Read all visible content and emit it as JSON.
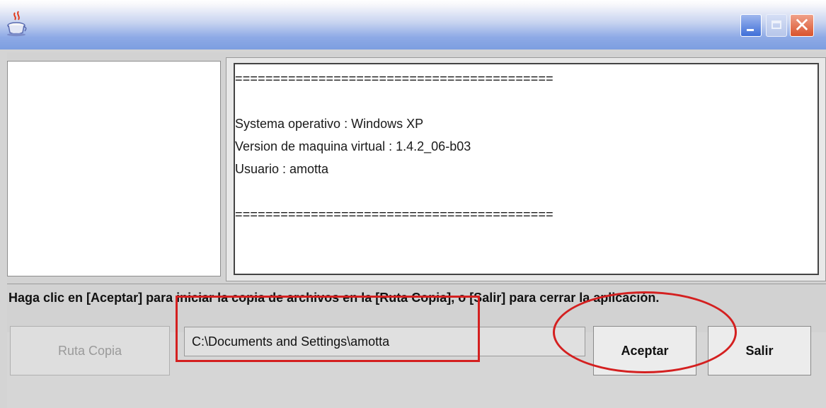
{
  "window": {
    "icon": "java-cup-icon",
    "buttons": {
      "minimize_icon": "minimize-icon",
      "maximize_icon": "maximize-icon",
      "close_glyph": "✕"
    }
  },
  "log": {
    "lines": [
      "==========================================",
      "",
      "Systema operativo : Windows XP",
      "Version de maquina virtual : 1.4.2_06-b03",
      "Usuario : amotta",
      "",
      "=========================================="
    ]
  },
  "instruction": "Haga clic en [Aceptar] para iniciar la copia de archivos en la [Ruta Copia], o [Salir] para cerrar la aplicación.",
  "controls": {
    "ruta_copia_label": "Ruta Copia",
    "path_value": "C:\\Documents and Settings\\amotta",
    "aceptar_label": "Aceptar",
    "salir_label": "Salir"
  },
  "annotations": {
    "highlight_color": "#d42020"
  }
}
